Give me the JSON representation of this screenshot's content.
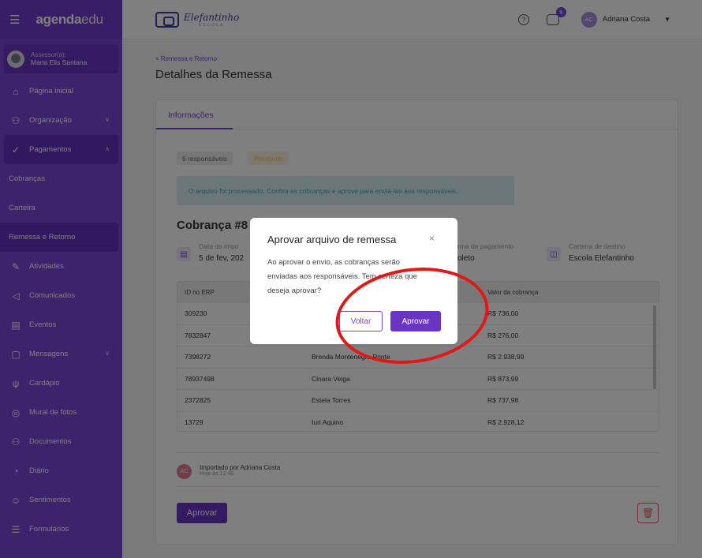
{
  "sidebar": {
    "logo_bold": "agenda",
    "logo_light": "edu",
    "assessor_label": "Assessor(a):",
    "assessor_name": "Maria Elis Santana",
    "items": [
      {
        "label": "Página inicial",
        "icon": "home-icon"
      },
      {
        "label": "Organização",
        "icon": "org-icon",
        "chevron": "∨"
      },
      {
        "label": "Pagamentos",
        "icon": "payments-icon",
        "chevron": "∧"
      },
      {
        "label": "Cobranças"
      },
      {
        "label": "Carteira"
      },
      {
        "label": "Remessa e Retorno"
      },
      {
        "label": "Atividades",
        "icon": "pencil-icon"
      },
      {
        "label": "Comunicados",
        "icon": "megaphone-icon"
      },
      {
        "label": "Eventos",
        "icon": "calendar-icon"
      },
      {
        "label": "Mensagens",
        "icon": "message-icon",
        "chevron": "∨"
      },
      {
        "label": "Cardápio",
        "icon": "cutlery-icon"
      },
      {
        "label": "Mural de fotos",
        "icon": "camera-icon"
      },
      {
        "label": "Documentos",
        "icon": "documents-icon"
      },
      {
        "label": "Diário",
        "icon": "diary-icon"
      },
      {
        "label": "Sentimentos",
        "icon": "feelings-icon"
      },
      {
        "label": "Formulários",
        "icon": "forms-icon"
      }
    ]
  },
  "topbar": {
    "school_name": "Elefantinho",
    "school_sub": "ESCOLA",
    "notifications": "9",
    "user_initials": "AC",
    "user_name": "Adriana Costa"
  },
  "page": {
    "breadcrumb": "< Remessa e Retorno",
    "title": "Detalhes da Remessa",
    "tab": "Informações",
    "chip_count": "6 responsáveis",
    "chip_status": "Pendente",
    "alert": "O arquivo foi processado. Confira as cobranças e aprove para enviá-las aos responsáveis.",
    "cobranca_title": "Cobrança #8",
    "meta": [
      {
        "label": "Data da impo",
        "value": "5 de fev, 202"
      },
      {
        "label": "rma de pagamento",
        "value": "oleto"
      },
      {
        "label": "Carteira de destino",
        "value": "Escola Elefantinho"
      }
    ],
    "table": {
      "headers": [
        "ID no ERP",
        "",
        "Valor da cobrança"
      ],
      "rows": [
        [
          "309230",
          "",
          "R$ 736,00"
        ],
        [
          "7832847",
          "",
          "R$ 276,00"
        ],
        [
          "7398272",
          "Brenda Montenegro Ponte",
          "R$ 2.938,99"
        ],
        [
          "78937498",
          "Cinara Veiga",
          "R$ 873,99"
        ],
        [
          "2372825",
          "Estela Torres",
          "R$ 737,98"
        ],
        [
          "13729",
          "Iuri Aquino",
          "R$ 2.928,12"
        ]
      ]
    },
    "importer_initials": "AC",
    "importer_name": "Importado por Adriana Costa",
    "importer_date": "Hoje às 12:48",
    "approve_button": "Aprovar"
  },
  "modal": {
    "title": "Aprovar arquivo de remessa",
    "close": "×",
    "body": "Ao aprovar o envio, as cobranças serão enviadas aos responsáveis. Tem certeza que deseja aprovar?",
    "cancel": "Voltar",
    "confirm": "Aprovar"
  },
  "colors": {
    "primary": "#7a45d8",
    "highlight": "#e01818"
  }
}
